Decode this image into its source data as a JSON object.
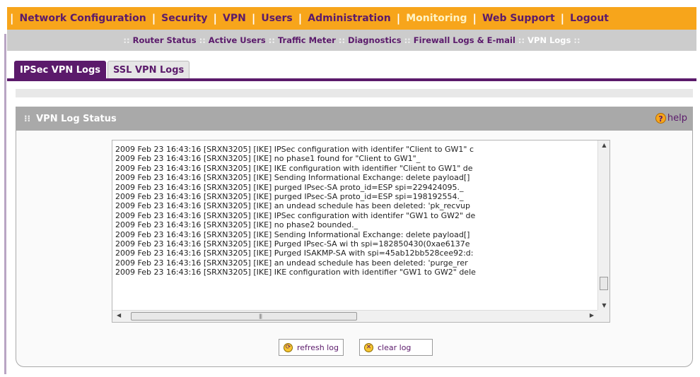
{
  "top_nav": {
    "items": [
      {
        "label": "Network Configuration",
        "active": false
      },
      {
        "label": "Security",
        "active": false
      },
      {
        "label": "VPN",
        "active": false
      },
      {
        "label": "Users",
        "active": false
      },
      {
        "label": "Administration",
        "active": false
      },
      {
        "label": "Monitoring",
        "active": true
      },
      {
        "label": "Web Support",
        "active": false
      },
      {
        "label": "Logout",
        "active": false
      }
    ]
  },
  "sub_nav": {
    "items": [
      {
        "label": "Router Status",
        "active": false
      },
      {
        "label": "Active Users",
        "active": false
      },
      {
        "label": "Traffic Meter",
        "active": false
      },
      {
        "label": "Diagnostics",
        "active": false
      },
      {
        "label": "Firewall Logs & E-mail",
        "active": false
      },
      {
        "label": "VPN Logs",
        "active": true
      }
    ]
  },
  "tabs": [
    {
      "label": "IPSec VPN Logs",
      "active": true
    },
    {
      "label": "SSL VPN Logs",
      "active": false
    }
  ],
  "panel": {
    "title": "VPN Log Status",
    "help_label": "help"
  },
  "log": {
    "lines": [
      "2009 Feb 23 16:43:16 [SRXN3205] [IKE] IPSec configuration with identifer \"Client to GW1\" c",
      "2009 Feb 23 16:43:16 [SRXN3205] [IKE] no phase1 found for \"Client to GW1\"_",
      "2009 Feb 23 16:43:16 [SRXN3205] [IKE] IKE configuration with identifier \"Client to GW1\" de",
      "2009 Feb 23 16:43:16 [SRXN3205] [IKE] Sending Informational Exchange: delete payload[]",
      "2009 Feb 23 16:43:16 [SRXN3205] [IKE] purged IPsec-SA proto_id=ESP spi=229424095._",
      "2009 Feb 23 16:43:16 [SRXN3205] [IKE] purged IPsec-SA proto_id=ESP spi=198192554._",
      "2009 Feb 23 16:43:16 [SRXN3205] [IKE] an undead schedule has been deleted: 'pk_recvup",
      "2009 Feb 23 16:43:16 [SRXN3205] [IKE] IPSec configuration with identifer \"GW1 to GW2\" de",
      "2009 Feb 23 16:43:16 [SRXN3205] [IKE] no phase2 bounded._",
      "2009 Feb 23 16:43:16 [SRXN3205] [IKE] Sending Informational Exchange: delete payload[]",
      "2009 Feb 23 16:43:16 [SRXN3205] [IKE] Purged IPsec-SA wi th spi=182850430(0xae6137e",
      "2009 Feb 23 16:43:16 [SRXN3205] [IKE] Purged ISAKMP-SA with spi=45ab12bb528cee92:d:",
      "2009 Feb 23 16:43:16 [SRXN3205] [IKE] an undead schedule has been deleted: 'purge_rer",
      "2009 Feb 23 16:43:16 [SRXN3205] [IKE] IKE configuration with identifier \"GW1 to GW2\" dele"
    ]
  },
  "buttons": {
    "refresh": "refresh log",
    "clear": "clear log"
  },
  "colors": {
    "brand_orange": "#f7a51b",
    "brand_purple": "#5b1a6b",
    "panel_grey": "#a9a9a9"
  }
}
